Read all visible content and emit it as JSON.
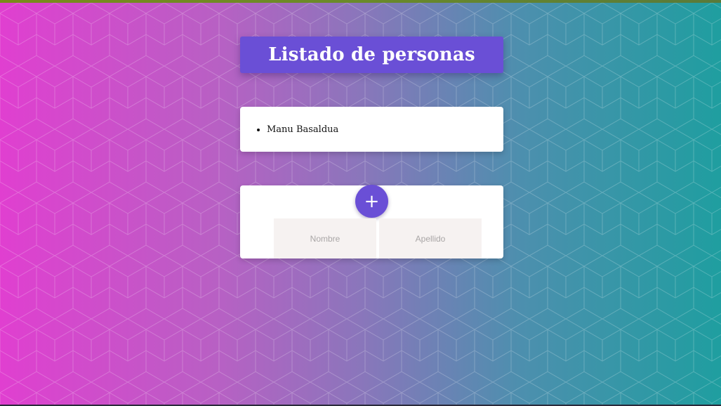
{
  "page": {
    "title": "Listado de personas"
  },
  "people_list": {
    "items": [
      "Manu Basaldua"
    ]
  },
  "form": {
    "add_button_label": "+",
    "nombre": {
      "placeholder": "Nombre",
      "value": ""
    },
    "apellido": {
      "placeholder": "Apellido",
      "value": ""
    }
  },
  "icons": {
    "add": "plus-icon"
  },
  "colors": {
    "accent": "#6a4fd6",
    "gradient_left": "#e03fd0",
    "gradient_right": "#1f9ea0",
    "input_background": "#f6f2f1"
  }
}
